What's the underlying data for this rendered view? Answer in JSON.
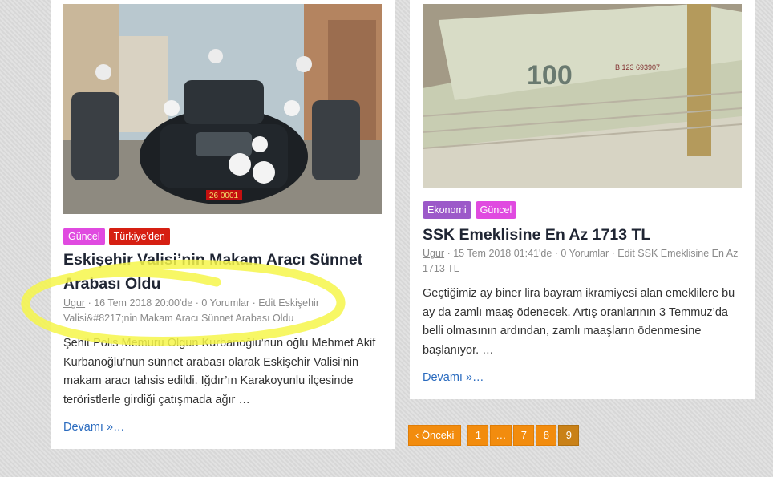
{
  "left_post": {
    "photo_alt": "Eskişehir Valisi makam aracı",
    "plate_text": "26 0001",
    "categories": [
      "Güncel",
      "Türkiye'den"
    ],
    "title": "Eskişehir Valisi’nin Makam Aracı Sünnet Arabası Oldu",
    "author": "Ugur",
    "meta_rest": " · 16 Tem 2018 20:00'de · 0 Yorumlar · Edit Eskişehir Valisi&#8217;nin Makam Aracı Sünnet Arabası Oldu",
    "excerpt": "Şehit Polis Memuru Olgun Kurbanoğlu’nun oğlu Mehmet Akif Kurbanoğlu’nun sünnet arabası olarak Eskişehir Valisi’nin makam aracı tahsis edildi. Iğdır’ın Karakoyunlu ilçesinde teröristlerle girdiği çatışmada ağır …",
    "read_more": "Devamı »…"
  },
  "right_post": {
    "photo_alt": "100 TL banknot destesi",
    "banknote_text": "100",
    "serial_text": "B 123 693907",
    "categories": [
      "Ekonomi",
      "Güncel"
    ],
    "title": "SSK Emeklisine En Az 1713 TL",
    "author": "Ugur",
    "meta_rest": " · 15 Tem 2018 01:41'de · 0 Yorumlar · Edit SSK Emeklisine En Az 1713 TL",
    "excerpt": "Geçtiğimiz ay biner lira bayram ikramiyesi alan emeklilere bu ay da zamlı maaş ödenecek. Artış oranlarının 3 Temmuz’da belli olmasının ardından, zamlı maaşların ödenmesine başlanıyor. …",
    "read_more": "Devamı »…"
  },
  "pagination": {
    "prev": "‹ Önceki",
    "pages": [
      "1",
      "…",
      "7",
      "8",
      "9"
    ],
    "current": "9"
  },
  "colors": {
    "cat_guncel": "#e04ae0",
    "cat_turkiye": "#d61f12",
    "cat_ekonomi": "#9c59c9",
    "link": "#2a6bbf",
    "pager": "#f28c0e",
    "highlight": "#f6f64a"
  }
}
